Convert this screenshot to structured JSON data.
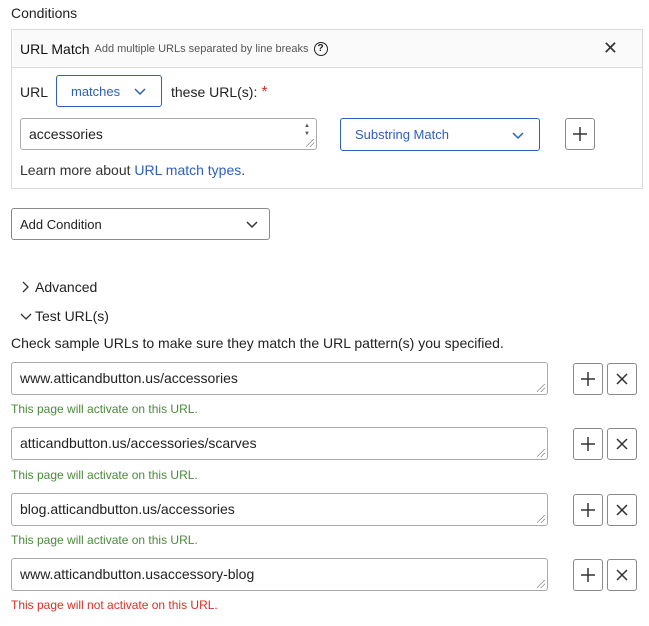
{
  "section_title": "Conditions",
  "condition": {
    "title": "URL Match",
    "hint": "Add multiple URLs separated by line breaks",
    "help_icon": "question-circle-icon",
    "close_icon": "close-icon",
    "url_label": "URL",
    "operator_value": "matches",
    "these_urls_label": "these URL(s):",
    "required_mark": "*",
    "url_value": "accessories",
    "match_type_value": "Substring Match",
    "add_icon": "plus-icon",
    "learn_prefix": "Learn more about ",
    "learn_link": "URL match types",
    "learn_suffix": "."
  },
  "add_condition_label": "Add Condition",
  "advanced_label": "Advanced",
  "test_urls_label": "Test URL(s)",
  "instructions": "Check sample URLs to make sure they match the URL pattern(s) you specified.",
  "test_urls": [
    {
      "value": "www.atticandbutton.us/accessories",
      "status": "This page will activate on this URL.",
      "ok": true
    },
    {
      "value": "atticandbutton.us/accessories/scarves",
      "status": "This page will activate on this URL.",
      "ok": true
    },
    {
      "value": "blog.atticandbutton.us/accessories",
      "status": "This page will activate on this URL.",
      "ok": true
    },
    {
      "value": "www.atticandbutton.usaccessory-blog",
      "status": "This page will not activate on this URL.",
      "ok": false
    }
  ],
  "colors": {
    "accent": "#2d5fbf",
    "success": "#4b8a3a",
    "error": "#d93025"
  }
}
